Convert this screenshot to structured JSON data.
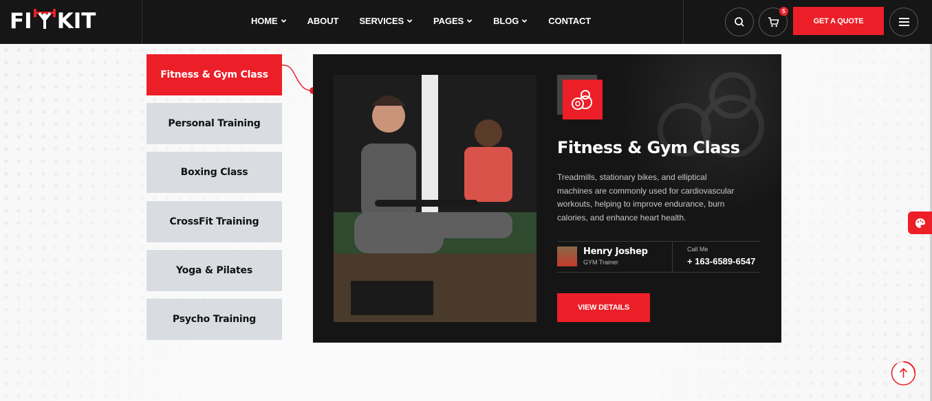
{
  "header": {
    "logo_left": "FI",
    "logo_right": "KIT",
    "nav": [
      {
        "label": "HOME",
        "dropdown": true
      },
      {
        "label": "ABOUT",
        "dropdown": false
      },
      {
        "label": "SERVICES",
        "dropdown": true
      },
      {
        "label": "PAGES",
        "dropdown": true
      },
      {
        "label": "BLOG",
        "dropdown": true
      },
      {
        "label": "CONTACT",
        "dropdown": false
      }
    ],
    "cart_count": "5",
    "quote_label": "GET A QUOTE"
  },
  "tabs": [
    {
      "label": "Fitness & Gym Class",
      "active": true
    },
    {
      "label": "Personal Training",
      "active": false
    },
    {
      "label": "Boxing Class",
      "active": false
    },
    {
      "label": "CrossFit Training",
      "active": false
    },
    {
      "label": "Yoga & Pilates",
      "active": false
    },
    {
      "label": "Psycho Training",
      "active": false
    }
  ],
  "card": {
    "title": "Fitness & Gym Class",
    "description": "Treadmills, stationary bikes, and elliptical machines are commonly used for cardiovascular workouts, helping to improve endurance, burn calories, and enhance heart health.",
    "trainer_name": "Henry Joshep",
    "trainer_role": "GYM Trainer",
    "call_label": "Call Me",
    "call_number": "+ 163-6589-6547",
    "button_label": "VIEW DETAILS"
  },
  "colors": {
    "accent": "#ec1f28",
    "dark": "#151515",
    "tab_bg": "#d9dde1"
  }
}
